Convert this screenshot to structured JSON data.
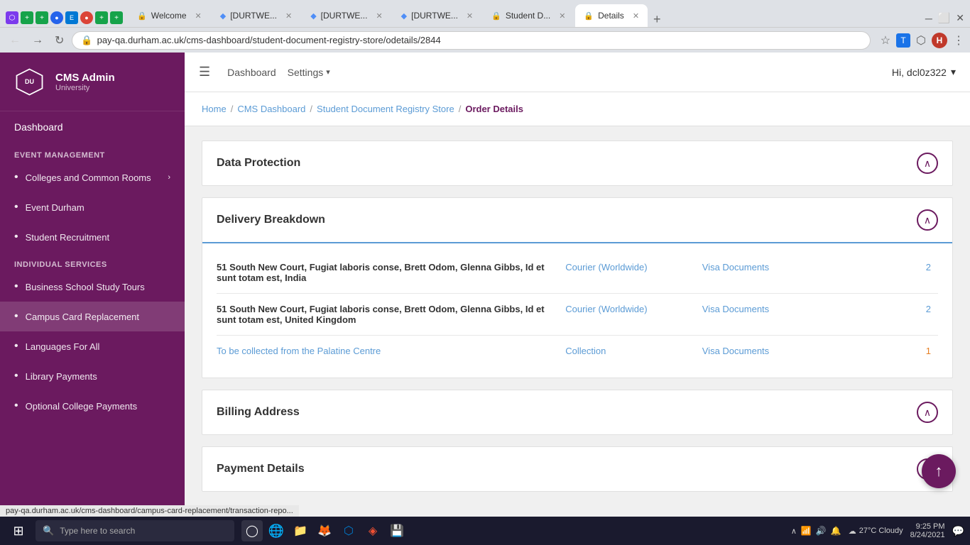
{
  "browser": {
    "tabs": [
      {
        "label": "Welcome",
        "active": false,
        "icon": "🔒"
      },
      {
        "label": "[DURTWE...",
        "active": false,
        "icon": "◆"
      },
      {
        "label": "[DURTWE...",
        "active": false,
        "icon": "◆"
      },
      {
        "label": "[DURTWE...",
        "active": false,
        "icon": "◆"
      },
      {
        "label": "Student D...",
        "active": false,
        "icon": "🔒"
      },
      {
        "label": "Details",
        "active": true,
        "icon": "🔒"
      }
    ],
    "address": "pay-qa.durham.ac.uk/cms-dashboard/student-document-registry-store/odetails/2844"
  },
  "topnav": {
    "hamburger": "☰",
    "links": [
      "Dashboard",
      "Settings"
    ],
    "settings_arrow": "▾",
    "user": "Hi, dcl0z322",
    "user_avatar": "H"
  },
  "breadcrumb": {
    "home": "Home",
    "cms_dashboard": "CMS Dashboard",
    "store": "Student Document Registry Store",
    "current": "Order Details"
  },
  "sidebar": {
    "logo_text": "CMS Admin",
    "university": "University",
    "dashboard": "Dashboard",
    "sections": [
      {
        "label": "EVENT MANAGEMENT",
        "items": [
          {
            "name": "Colleges and Common Rooms",
            "has_chevron": true
          },
          {
            "name": "Event Durham",
            "has_chevron": false
          },
          {
            "name": "Student Recruitment",
            "has_chevron": false
          }
        ]
      },
      {
        "label": "INDIVIDUAL SERVICES",
        "items": [
          {
            "name": "Business School Study Tours",
            "has_chevron": false
          },
          {
            "name": "Campus Card Replacement",
            "has_chevron": false,
            "active": true
          },
          {
            "name": "Languages For All",
            "has_chevron": false
          },
          {
            "name": "Library Payments",
            "has_chevron": false
          },
          {
            "name": "Optional College Payments",
            "has_chevron": false
          }
        ]
      }
    ]
  },
  "content": {
    "sections": [
      {
        "id": "data-protection",
        "title": "Data Protection",
        "expanded": true,
        "has_body": false
      },
      {
        "id": "delivery-breakdown",
        "title": "Delivery Breakdown",
        "expanded": true,
        "has_body": true,
        "deliveries": [
          {
            "address": "51 South New Court, Fugiat laboris conse, Brett Odom, Glenna Gibbs, Id et sunt totam est, India",
            "method": "Courier (Worldwide)",
            "doc_type": "Visa Documents",
            "count": "2"
          },
          {
            "address": "51 South New Court, Fugiat laboris conse, Brett Odom, Glenna Gibbs, Id et sunt totam est, United Kingdom",
            "method": "Courier (Worldwide)",
            "doc_type": "Visa Documents",
            "count": "2"
          },
          {
            "address": "To be collected from the Palatine Centre",
            "method": "Collection",
            "doc_type": "Visa Documents",
            "count": "1",
            "is_collection": true
          }
        ]
      },
      {
        "id": "billing-address",
        "title": "Billing Address",
        "expanded": true,
        "has_body": false
      },
      {
        "id": "payment-details",
        "title": "Payment Details",
        "expanded": true,
        "has_body": false
      }
    ]
  },
  "taskbar": {
    "search_placeholder": "Type here to search",
    "time": "9:25 PM",
    "date": "8/24/2021",
    "weather": "27°C  Cloudy"
  },
  "status_url": "pay-qa.durham.ac.uk/cms-dashboard/campus-card-replacement/transaction-repo..."
}
